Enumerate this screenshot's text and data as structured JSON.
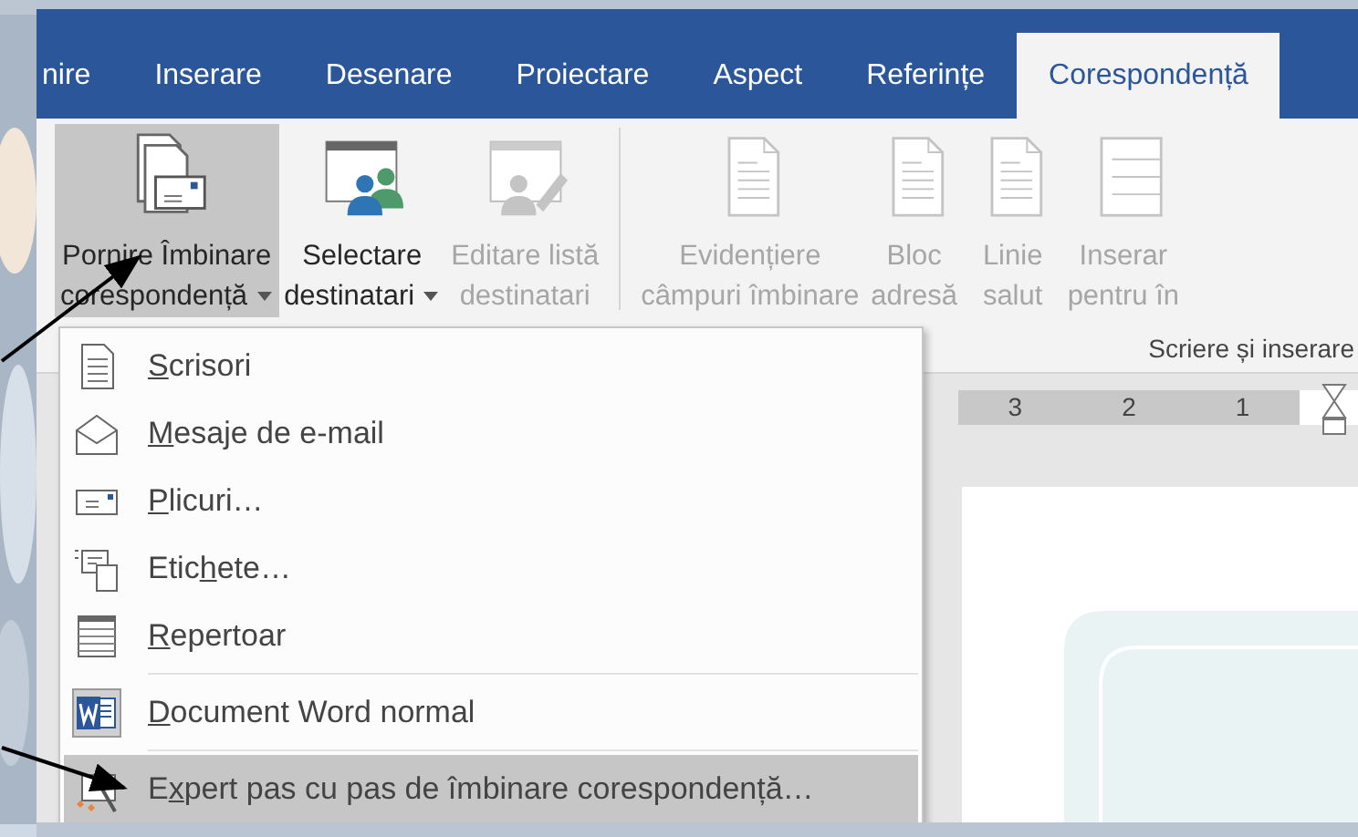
{
  "tabs": [
    {
      "label": "nire",
      "selected": false
    },
    {
      "label": "Inserare",
      "selected": false
    },
    {
      "label": "Desenare",
      "selected": false
    },
    {
      "label": "Proiectare",
      "selected": false
    },
    {
      "label": "Aspect",
      "selected": false
    },
    {
      "label": "Referințe",
      "selected": false
    },
    {
      "label": "Corespondență",
      "selected": true
    }
  ],
  "ribbon": {
    "buttons": [
      {
        "kind": "start-merge",
        "line1": "Pornire Îmbinare",
        "line2": "corespondență",
        "dropdown": true,
        "pressed": true,
        "disabled": false
      },
      {
        "kind": "recipients",
        "line1": "Selectare",
        "line2": "destinatari",
        "dropdown": true,
        "pressed": false,
        "disabled": false
      },
      {
        "kind": "edit-list",
        "line1": "Editare listă",
        "line2": "destinatari",
        "dropdown": false,
        "pressed": false,
        "disabled": true
      },
      {
        "kind": "highlight",
        "line1": "Evidențiere",
        "line2": "câmpuri îmbinare",
        "dropdown": false,
        "pressed": false,
        "disabled": true
      },
      {
        "kind": "address",
        "line1": "Bloc",
        "line2": "adresă",
        "dropdown": false,
        "pressed": false,
        "disabled": true
      },
      {
        "kind": "greeting",
        "line1": "Linie",
        "line2": "salut",
        "dropdown": false,
        "pressed": false,
        "disabled": true
      },
      {
        "kind": "insert",
        "line1": "Inserar",
        "line2": "pentru în",
        "dropdown": false,
        "pressed": false,
        "disabled": true
      }
    ],
    "group_label": "Scriere și inserare"
  },
  "menu": {
    "items": [
      {
        "kind": "letters",
        "key": "S",
        "post": "crisori",
        "highlighted": false,
        "separator_before": false
      },
      {
        "kind": "email",
        "key": "M",
        "post": "esaje de e-mail",
        "highlighted": false,
        "separator_before": false
      },
      {
        "kind": "envelopes",
        "key": "P",
        "post": "licuri…",
        "highlighted": false,
        "separator_before": false
      },
      {
        "kind": "labels",
        "pre": "Etic",
        "key": "h",
        "post": "ete…",
        "highlighted": false,
        "separator_before": false
      },
      {
        "kind": "directory",
        "key": "R",
        "post": "epertoar",
        "highlighted": false,
        "separator_before": false
      },
      {
        "kind": "word",
        "key": "D",
        "post": "ocument Word normal",
        "highlighted": false,
        "separator_before": true
      },
      {
        "kind": "wizard",
        "pre": "E",
        "key": "x",
        "post": "pert pas cu pas de îmbinare corespondență…",
        "highlighted": true,
        "separator_before": true
      }
    ]
  },
  "ruler": {
    "numbers": [
      "3",
      "2",
      "1"
    ]
  }
}
